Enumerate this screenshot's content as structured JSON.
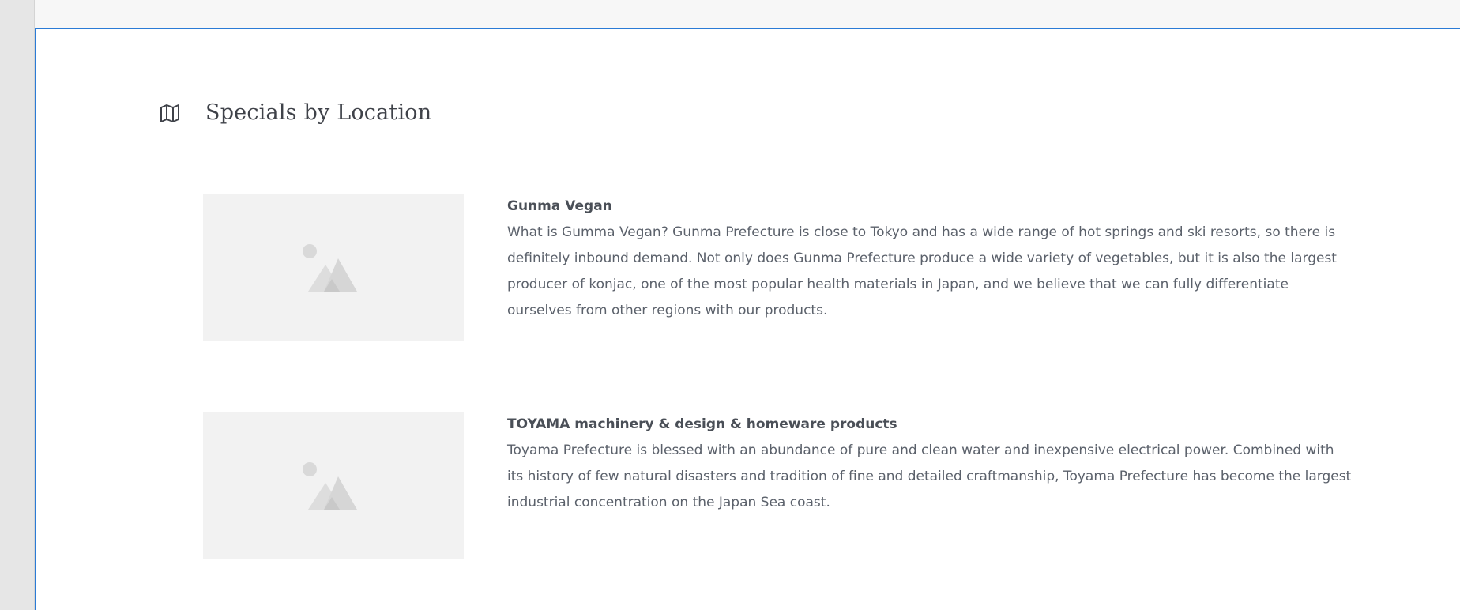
{
  "section": {
    "title": "Specials by Location",
    "icon": "map-icon"
  },
  "specials": [
    {
      "title": "Gunma Vegan",
      "description": "What is Gumma Vegan? Gunma Prefecture is close to Tokyo and has a wide range of hot springs and ski resorts,  so  there is definitely inbound demand. Not only does Gunma Prefecture produce a wide variety of vegetables, but it is also the largest producer of konjac, one of the most popular health materials in Japan, and we believe that we can fully differentiate ourselves from other regions with our products.",
      "image_icon": "image-placeholder-icon"
    },
    {
      "title": "TOYAMA machinery & design & homeware products",
      "description": "Toyama Prefecture is blessed with an abundance of pure and clean water and inexpensive electrical power. Combined with its history of few natural disasters and tradition of fine and detailed craftmanship, Toyama Prefecture has become the largest industrial concentration on the Japan Sea coast.",
      "image_icon": "image-placeholder-icon"
    }
  ],
  "colors": {
    "accent_border": "#2b7bd6",
    "placeholder_bg": "#f2f2f2",
    "text": "#5b616b"
  }
}
